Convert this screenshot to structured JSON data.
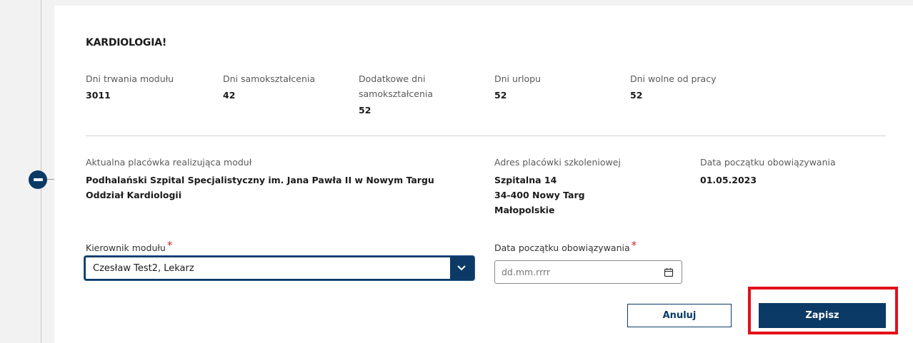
{
  "module": {
    "title": "KARDIOLOGIA!",
    "stats": [
      {
        "label": "Dni trwania modułu",
        "value": "3011"
      },
      {
        "label": "Dni samokształcenia",
        "value": "42"
      },
      {
        "label": "Dodatkowe dni samokształcenia",
        "value": "52"
      },
      {
        "label": "Dni urlopu",
        "value": "52"
      },
      {
        "label": "Dni wolne od pracy",
        "value": "52"
      }
    ]
  },
  "facility": {
    "current_label": "Aktualna placówka realizująca moduł",
    "current_name_line1": "Podhalański Szpital Specjalistyczny im. Jana Pawła II w Nowym Targu",
    "current_name_line2": "Oddział Kardiologii",
    "address_label": "Adres placówki szkoleniowej",
    "address_line1": "Szpitalna 14",
    "address_line2": "34-400 Nowy Targ",
    "address_line3": "Małopolskie",
    "start_label": "Data początku obowiązywania",
    "start_value": "01.05.2023"
  },
  "form": {
    "manager_label": "Kierownik modułu",
    "manager_value": "Czesław Test2, Lekarz",
    "date_label": "Data początku obowiązywania",
    "date_placeholder": "dd.mm.rrrr",
    "required_mark": "*"
  },
  "actions": {
    "cancel_label": "Anuluj",
    "save_label": "Zapisz"
  },
  "icons": {
    "collapse": "minus-circle-icon",
    "dropdown": "chevron-down-icon",
    "calendar": "calendar-icon"
  },
  "colors": {
    "primary": "#0b3a66",
    "required": "#c62828",
    "highlight": "#e3101b"
  }
}
